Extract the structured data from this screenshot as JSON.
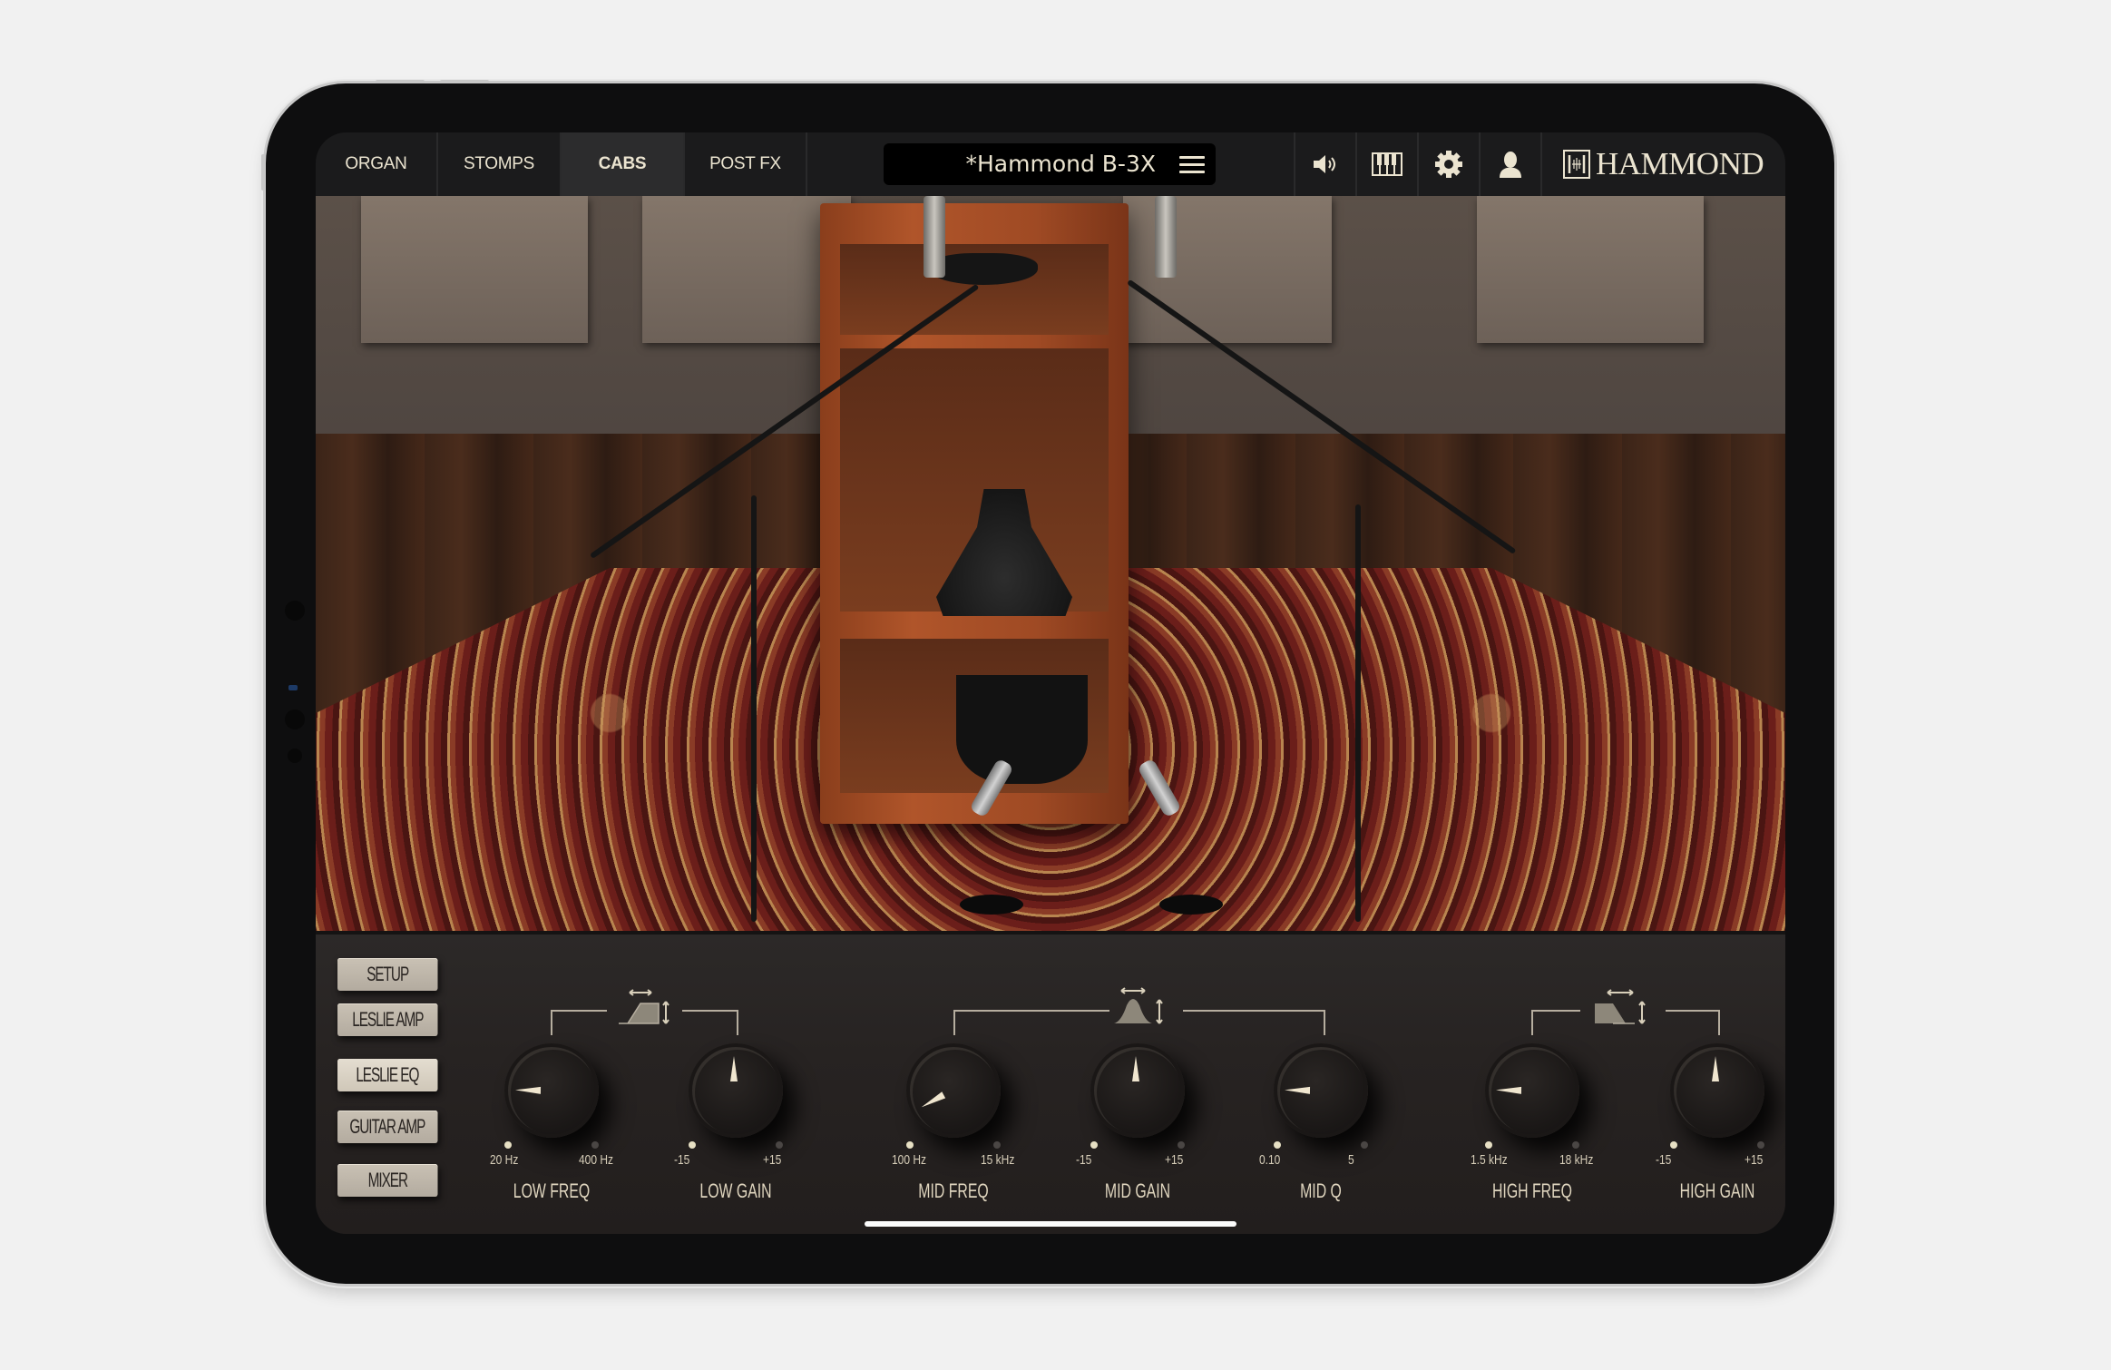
{
  "app": {
    "brand": "HAMMOND",
    "preset_name": "*Hammond B-3X"
  },
  "tabs": [
    {
      "label": "ORGAN",
      "active": false
    },
    {
      "label": "STOMPS",
      "active": false
    },
    {
      "label": "CABS",
      "active": true
    },
    {
      "label": "POST FX",
      "active": false
    }
  ],
  "toolbar_icons": [
    "speaker-icon",
    "keyboard-icon",
    "gear-icon",
    "user-icon",
    "menu-icon"
  ],
  "side_menu": [
    {
      "label": "SETUP",
      "active": false
    },
    {
      "label": "LESLIE AMP",
      "active": false
    },
    {
      "label": "LESLIE EQ",
      "active": true
    },
    {
      "label": "GUITAR AMP",
      "active": false
    },
    {
      "label": "MIXER",
      "active": false
    }
  ],
  "eq": {
    "sections": [
      {
        "name": "low",
        "filter_icon": "low-shelf-icon"
      },
      {
        "name": "mid",
        "filter_icon": "peak-bell-icon"
      },
      {
        "name": "high",
        "filter_icon": "high-shelf-icon"
      }
    ],
    "knobs": [
      {
        "label": "LOW FREQ",
        "min": "20 Hz",
        "max": "400 Hz",
        "value_fraction": 0.17
      },
      {
        "label": "LOW GAIN",
        "min": "-15",
        "max": "+15",
        "value_fraction": 0.5
      },
      {
        "label": "MID FREQ",
        "min": "100 Hz",
        "max": "15 kHz",
        "value_fraction": 0.06
      },
      {
        "label": "MID GAIN",
        "min": "-15",
        "max": "+15",
        "value_fraction": 0.5
      },
      {
        "label": "MID Q",
        "min": "0.10",
        "max": "5",
        "value_fraction": 0.17
      },
      {
        "label": "HIGH FREQ",
        "min": "1.5 kHz",
        "max": "18 kHz",
        "value_fraction": 0.17
      },
      {
        "label": "HIGH GAIN",
        "min": "-15",
        "max": "+15",
        "value_fraction": 0.5
      }
    ]
  },
  "colors": {
    "accent_text": "#ebe4d0",
    "panel": "#272322",
    "active_dot": "#e7e0c4",
    "inactive_dot": "#4a4644"
  }
}
